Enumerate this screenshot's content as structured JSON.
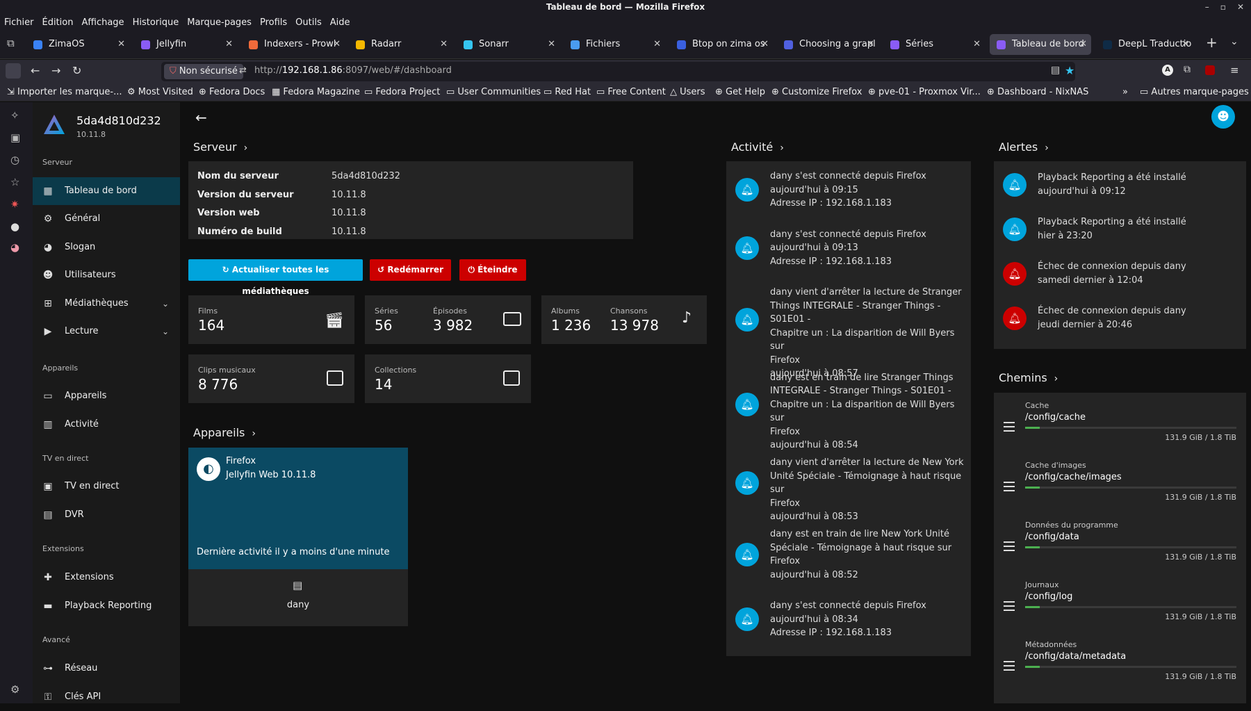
{
  "window": {
    "title": "Tableau de bord — Mozilla Firefox"
  },
  "menubar": [
    "Fichier",
    "Édition",
    "Affichage",
    "Historique",
    "Marque-pages",
    "Profils",
    "Outils",
    "Aide"
  ],
  "tabs": [
    {
      "label": "ZimaOS",
      "color": "#3a82f6"
    },
    {
      "label": "Jellyfin",
      "color": "#8a5cf6"
    },
    {
      "label": "Indexers - Prowl",
      "color": "#f06a3a"
    },
    {
      "label": "Radarr",
      "color": "#f5b800"
    },
    {
      "label": "Sonarr",
      "color": "#35c5f0"
    },
    {
      "label": "Fichiers",
      "color": "#4a9cf0"
    },
    {
      "label": "Btop on zima os",
      "color": "#3a60e0"
    },
    {
      "label": "Choosing a grapl",
      "color": "#5060e0"
    },
    {
      "label": "Séries",
      "color": "#8a5cf6"
    },
    {
      "label": "Tableau de bord",
      "color": "#8a5cf6"
    },
    {
      "label": "DeepL Traductio",
      "color": "#0f2b46"
    }
  ],
  "nav": {
    "security": "Non sécurisé",
    "url_host": "192.168.1.86",
    "url_prefix": "http://",
    "url_rest": ":8097/web/#/dashboard"
  },
  "bookmarks": [
    "Importer les marque-...",
    "Most Visited",
    "Fedora Docs",
    "Fedora Magazine",
    "Fedora Project",
    "User Communities",
    "Red Hat",
    "Free Content",
    "Users",
    "Get Help",
    "Customize Firefox",
    "pve-01 - Proxmox Vir...",
    "Dashboard - NixNAS",
    "Autres marque-pages"
  ],
  "server": {
    "name": "5da4d810d232",
    "version": "10.11.8"
  },
  "sidebar": {
    "sec_server": "Serveur",
    "items_server": [
      "Tableau de bord",
      "Général",
      "Slogan",
      "Utilisateurs",
      "Médiathèques",
      "Lecture"
    ],
    "sec_devices": "Appareils",
    "items_devices": [
      "Appareils",
      "Activité"
    ],
    "sec_live": "TV en direct",
    "items_live": [
      "TV en direct",
      "DVR"
    ],
    "sec_ext": "Extensions",
    "items_ext": [
      "Extensions",
      "Playback Reporting"
    ],
    "sec_adv": "Avancé",
    "items_adv": [
      "Réseau",
      "Clés API"
    ]
  },
  "serveur": {
    "title": "Serveur",
    "rows": [
      {
        "label": "Nom du serveur",
        "value": "5da4d810d232"
      },
      {
        "label": "Version du serveur",
        "value": "10.11.8"
      },
      {
        "label": "Version web",
        "value": "10.11.8"
      },
      {
        "label": "Numéro de build",
        "value": "10.11.8"
      }
    ],
    "btn_refresh": "Actualiser toutes les médiathèques",
    "btn_restart": "Redémarrer",
    "btn_shutdown": "Éteindre"
  },
  "stats": {
    "films_label": "Films",
    "films": "164",
    "series_label": "Séries",
    "series": "56",
    "episodes_label": "Épisodes",
    "episodes": "3 982",
    "albums_label": "Albums",
    "albums": "1 236",
    "songs_label": "Chansons",
    "songs": "13 978",
    "clips_label": "Clips musicaux",
    "clips": "8 776",
    "collections_label": "Collections",
    "collections": "14"
  },
  "appareils": {
    "title": "Appareils",
    "device_name": "Firefox",
    "device_app": "Jellyfin Web 10.11.8",
    "last_activity": "Dernière activité il y a moins d'une minute",
    "user": "dany"
  },
  "activite": {
    "title": "Activité",
    "items": [
      {
        "lines": [
          "dany s'est connecté depuis Firefox",
          "aujourd'hui à 09:15",
          "Adresse IP : 192.168.1.183"
        ]
      },
      {
        "lines": [
          "dany s'est connecté depuis Firefox",
          "aujourd'hui à 09:13",
          "Adresse IP : 192.168.1.183"
        ]
      },
      {
        "lines": [
          "dany vient d'arrêter la lecture de Stranger",
          "Things INTEGRALE - Stranger Things - S01E01 -",
          "Chapitre un : La disparition de Will Byers sur",
          "Firefox",
          "aujourd'hui à 08:57"
        ]
      },
      {
        "lines": [
          "dany est en train de lire Stranger Things",
          "INTEGRALE - Stranger Things - S01E01 -",
          "Chapitre un : La disparition de Will Byers sur",
          "Firefox",
          "aujourd'hui à 08:54"
        ]
      },
      {
        "lines": [
          "dany vient d'arrêter la lecture de New York",
          "Unité Spéciale - Témoignage à haut risque sur",
          "Firefox",
          "aujourd'hui à 08:53"
        ]
      },
      {
        "lines": [
          "dany est en train de lire New York Unité",
          "Spéciale - Témoignage à haut risque sur",
          "Firefox",
          "aujourd'hui à 08:52"
        ]
      },
      {
        "lines": [
          "dany s'est connecté depuis Firefox",
          "aujourd'hui à 08:34",
          "Adresse IP : 192.168.1.183"
        ]
      }
    ]
  },
  "alertes": {
    "title": "Alertes",
    "items": [
      {
        "text": "Playback Reporting a été installé",
        "date": "aujourd'hui à 09:12",
        "color": "#00a4dc"
      },
      {
        "text": "Playback Reporting a été installé",
        "date": "hier à 23:20",
        "color": "#00a4dc"
      },
      {
        "text": "Échec de connexion depuis dany",
        "date": "samedi dernier à 12:04",
        "color": "#cc0000"
      },
      {
        "text": "Échec de connexion depuis dany",
        "date": "jeudi dernier à 20:46",
        "color": "#cc0000"
      }
    ]
  },
  "chemins": {
    "title": "Chemins",
    "items": [
      {
        "label": "Cache",
        "path": "/config/cache",
        "size": "131.9 GiB / 1.8 TiB",
        "fill_pct": 7
      },
      {
        "label": "Cache d'images",
        "path": "/config/cache/images",
        "size": "131.9 GiB / 1.8 TiB",
        "fill_pct": 7
      },
      {
        "label": "Données du programme",
        "path": "/config/data",
        "size": "131.9 GiB / 1.8 TiB",
        "fill_pct": 7
      },
      {
        "label": "Journaux",
        "path": "/config/log",
        "size": "131.9 GiB / 1.8 TiB",
        "fill_pct": 7
      },
      {
        "label": "Métadonnées",
        "path": "/config/data/metadata",
        "size": "131.9 GiB / 1.8 TiB",
        "fill_pct": 7
      }
    ]
  },
  "colors": {
    "accent": "#00a4dc",
    "danger": "#cc0000",
    "selected": "#0b3a4a",
    "device_card": "#0b4a63"
  }
}
